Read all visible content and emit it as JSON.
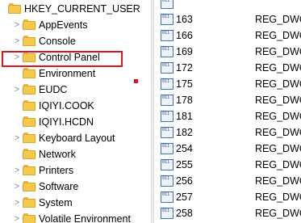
{
  "tree": {
    "items": [
      {
        "label": "HKEY_CURRENT_USER",
        "chevron": "",
        "level": 0
      },
      {
        "label": "AppEvents",
        "chevron": ">",
        "level": 1
      },
      {
        "label": "Console",
        "chevron": ">",
        "level": 1
      },
      {
        "label": "Control Panel",
        "chevron": ">",
        "level": 1
      },
      {
        "label": "Environment",
        "chevron": "",
        "level": 1
      },
      {
        "label": "EUDC",
        "chevron": ">",
        "level": 1
      },
      {
        "label": "IQIYI.COOK",
        "chevron": "",
        "level": 1
      },
      {
        "label": "IQIYI.HCDN",
        "chevron": "",
        "level": 1
      },
      {
        "label": "Keyboard Layout",
        "chevron": ">",
        "level": 1
      },
      {
        "label": "Network",
        "chevron": "",
        "level": 1
      },
      {
        "label": "Printers",
        "chevron": ">",
        "level": 1
      },
      {
        "label": "Software",
        "chevron": ">",
        "level": 1
      },
      {
        "label": "System",
        "chevron": ">",
        "level": 1
      },
      {
        "label": "Volatile Environment",
        "chevron": ">",
        "level": 1
      }
    ]
  },
  "values": {
    "icon": "registry-binary-value-icon",
    "icon_glyph": "011 110",
    "rows": [
      {
        "name": "",
        "type": ""
      },
      {
        "name": "163",
        "type": "REG_DWO"
      },
      {
        "name": "166",
        "type": "REG_DWO"
      },
      {
        "name": "169",
        "type": "REG_DWO"
      },
      {
        "name": "172",
        "type": "REG_DWO"
      },
      {
        "name": "175",
        "type": "REG_DWO"
      },
      {
        "name": "178",
        "type": "REG_DWO"
      },
      {
        "name": "181",
        "type": "REG_DWO"
      },
      {
        "name": "182",
        "type": "REG_DWO"
      },
      {
        "name": "254",
        "type": "REG_DWO"
      },
      {
        "name": "255",
        "type": "REG_DWO"
      },
      {
        "name": "256",
        "type": "REG_DWO"
      },
      {
        "name": "257",
        "type": "REG_DWO"
      },
      {
        "name": "258",
        "type": "REG_DWO"
      }
    ]
  },
  "colors": {
    "highlight_box": "#e0141e",
    "folder": "#f5c94e",
    "icon_border": "#3f6fb6"
  }
}
